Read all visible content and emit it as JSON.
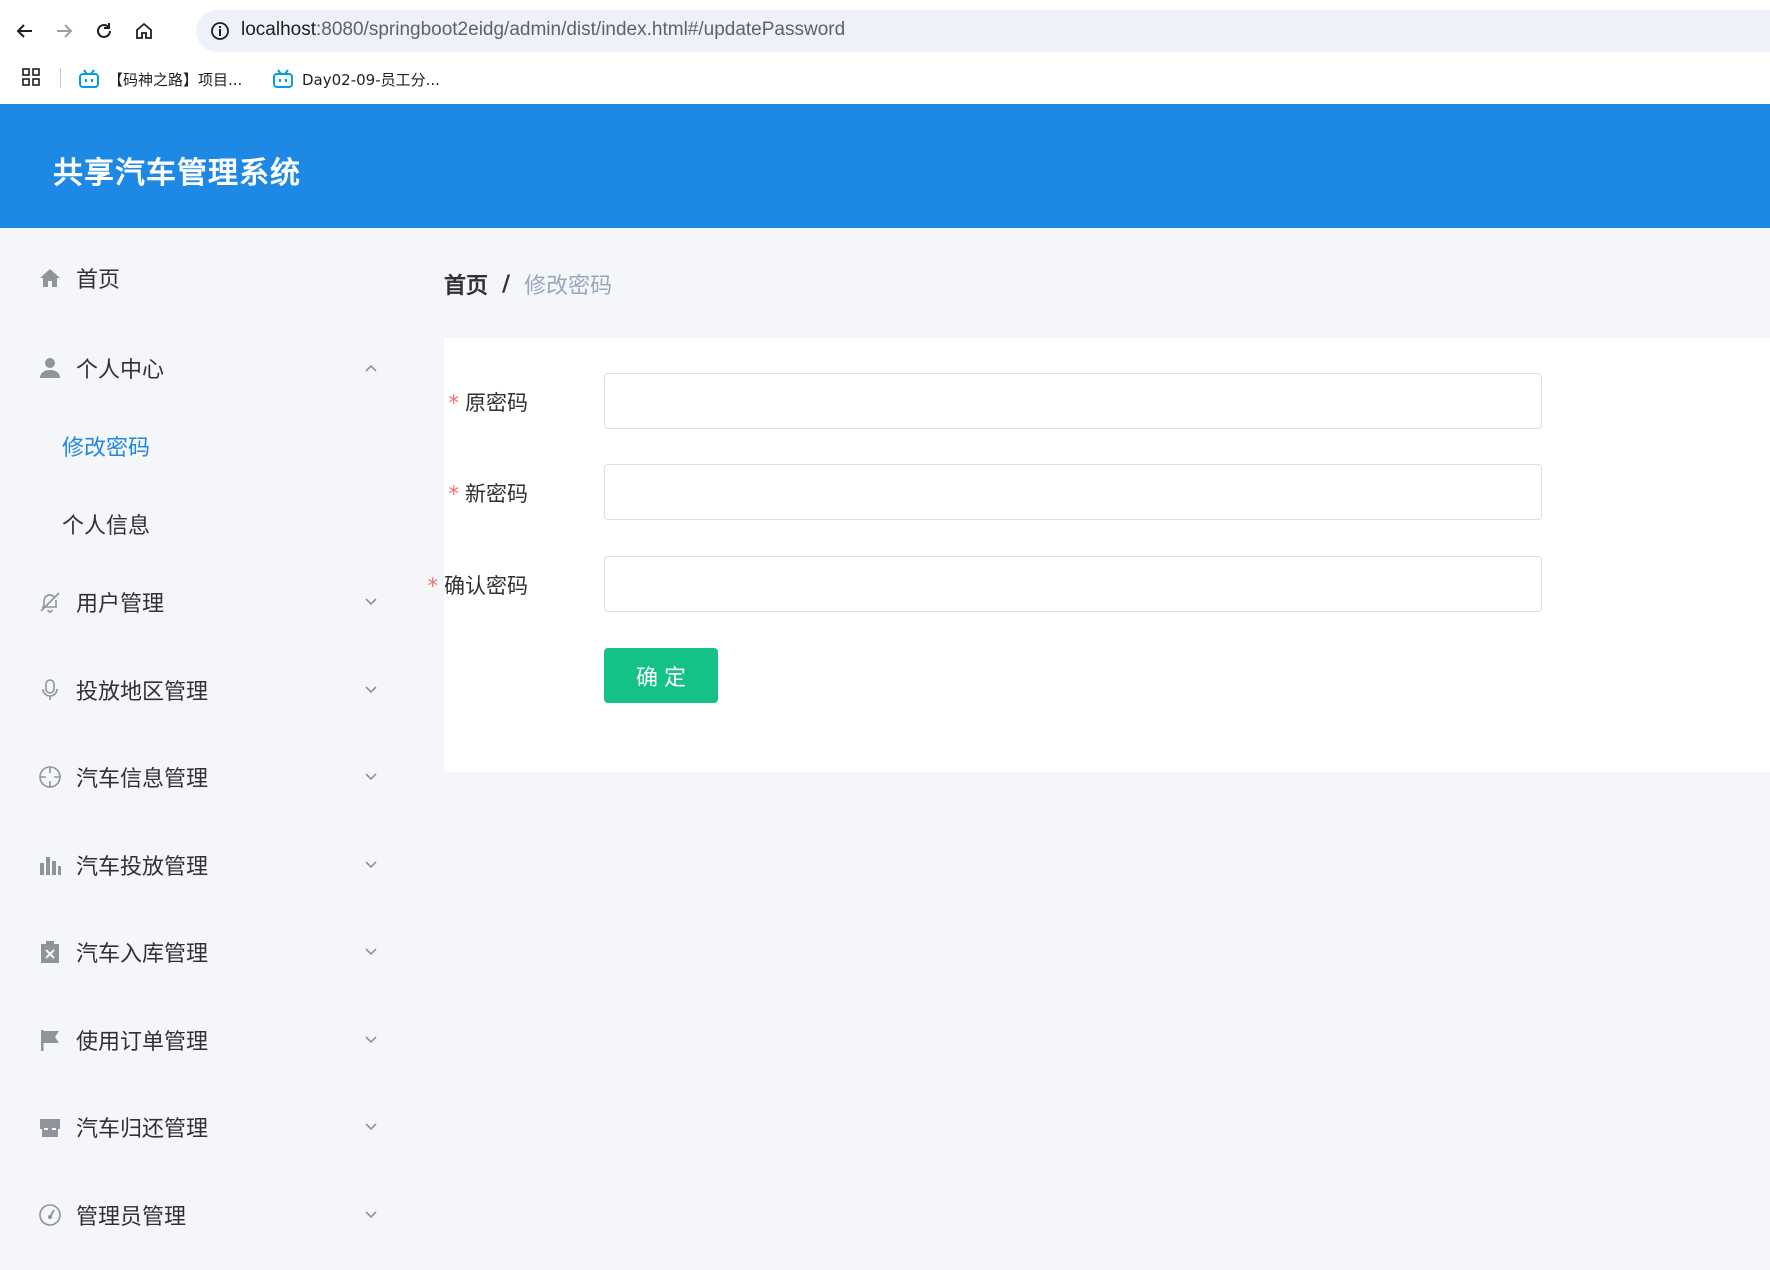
{
  "browser": {
    "url_host": "localhost",
    "url_path": ":8080/springboot2eidg/admin/dist/index.html#/updatePassword",
    "bookmarks": [
      {
        "label": "【码神之路】项目..."
      },
      {
        "label": "Day02-09-员工分..."
      }
    ]
  },
  "app": {
    "title": "共享汽车管理系统"
  },
  "sidebar": {
    "home": "首页",
    "personal_center": "个人中心",
    "sub_items": [
      "修改密码",
      "个人信息"
    ],
    "items": [
      {
        "label": "用户管理",
        "icon": "bell-off-icon"
      },
      {
        "label": "投放地区管理",
        "icon": "microphone-icon"
      },
      {
        "label": "汽车信息管理",
        "icon": "aim-icon"
      },
      {
        "label": "汽车投放管理",
        "icon": "bar-chart-icon"
      },
      {
        "label": "汽车入库管理",
        "icon": "clipboard-x-icon"
      },
      {
        "label": "使用订单管理",
        "icon": "flag-icon"
      },
      {
        "label": "汽车归还管理",
        "icon": "shop-icon"
      },
      {
        "label": "管理员管理",
        "icon": "gauge-icon"
      }
    ]
  },
  "breadcrumb": {
    "home": "首页",
    "separator": "/",
    "current": "修改密码"
  },
  "form": {
    "required_mark": "*",
    "old_password_label": "原密码",
    "new_password_label": "新密码",
    "confirm_password_label": "确认密码",
    "old_password_value": "",
    "new_password_value": "",
    "confirm_password_value": "",
    "submit_label": "确定"
  },
  "colors": {
    "header_bg": "#1e88e5",
    "active_menu": "#1e88e5",
    "submit_bg": "#13c189",
    "required": "#f56c6c"
  }
}
